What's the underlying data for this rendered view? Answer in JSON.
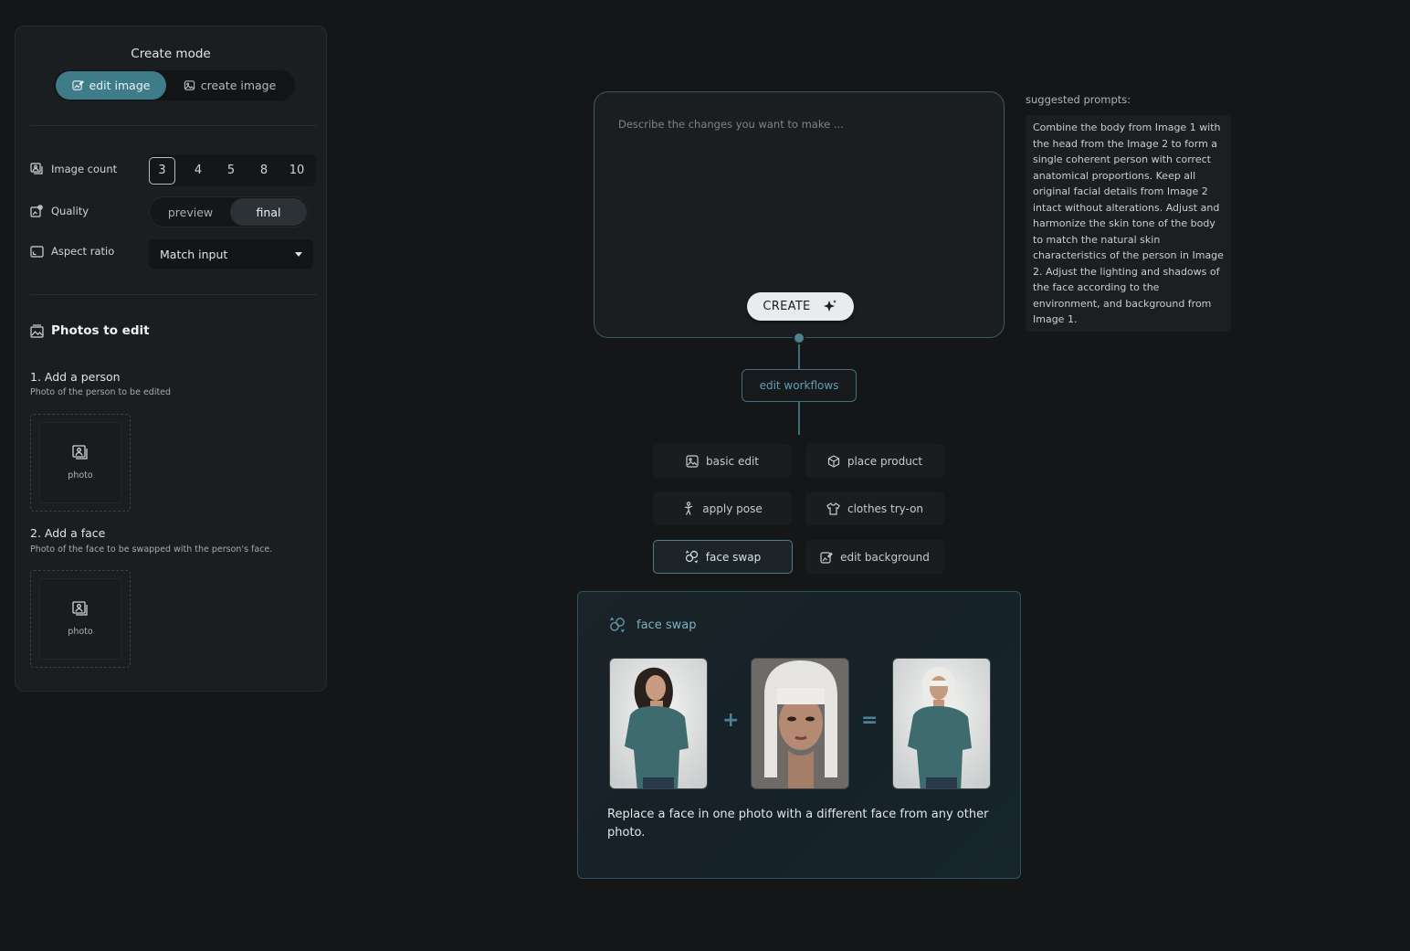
{
  "left_panel": {
    "mode_title": "Create mode",
    "modes": [
      {
        "label": "edit image",
        "active": true,
        "icon": "edit-image-icon"
      },
      {
        "label": "create image",
        "active": false,
        "icon": "image-icon"
      }
    ],
    "image_count": {
      "label": "Image count",
      "options": [
        "3",
        "4",
        "5",
        "8",
        "10"
      ],
      "selected": "3"
    },
    "quality": {
      "label": "Quality",
      "options": [
        "preview",
        "final"
      ],
      "selected": "final"
    },
    "aspect_ratio": {
      "label": "Aspect ratio",
      "value": "Match input"
    },
    "photos_section": {
      "title": "Photos to edit",
      "steps": [
        {
          "title": "1. Add a person",
          "subtitle": "Photo of the person to be edited",
          "slot_label": "photo"
        },
        {
          "title": "2. Add a face",
          "subtitle": "Photo of the face to be swapped with the person's face.",
          "slot_label": "photo"
        }
      ]
    }
  },
  "prompt": {
    "placeholder": "Describe the changes you want to make ...",
    "value": "",
    "create_label": "CREATE"
  },
  "workflows": {
    "title": "edit workflows",
    "items": [
      {
        "label": "basic edit",
        "icon": "image-edit-icon"
      },
      {
        "label": "place product",
        "icon": "box-icon"
      },
      {
        "label": "apply pose",
        "icon": "pose-icon"
      },
      {
        "label": "clothes try-on",
        "icon": "shirt-icon"
      },
      {
        "label": "face swap",
        "icon": "face-swap-icon",
        "active": true
      },
      {
        "label": "edit background",
        "icon": "background-edit-icon"
      }
    ]
  },
  "detail": {
    "title": "face swap",
    "plus": "+",
    "equals": "=",
    "description": "Replace a face in one photo with a different face from any other photo."
  },
  "suggestions": {
    "label": "suggested prompts:",
    "text": "Combine the body from Image 1 with the head from the Image 2 to form a single coherent person with correct anatomical proportions. Keep all original facial details from Image 2 intact without alterations. Adjust and harmonize the skin tone of the body to match the natural skin characteristics of the person in Image 2. Adjust the lighting and shadows of the face according to the environment, and background from Image 1."
  },
  "colors": {
    "accent": "#3e7c89",
    "accent_text": "#5f9eae",
    "background": "#141617",
    "panel": "#1b1e20"
  }
}
